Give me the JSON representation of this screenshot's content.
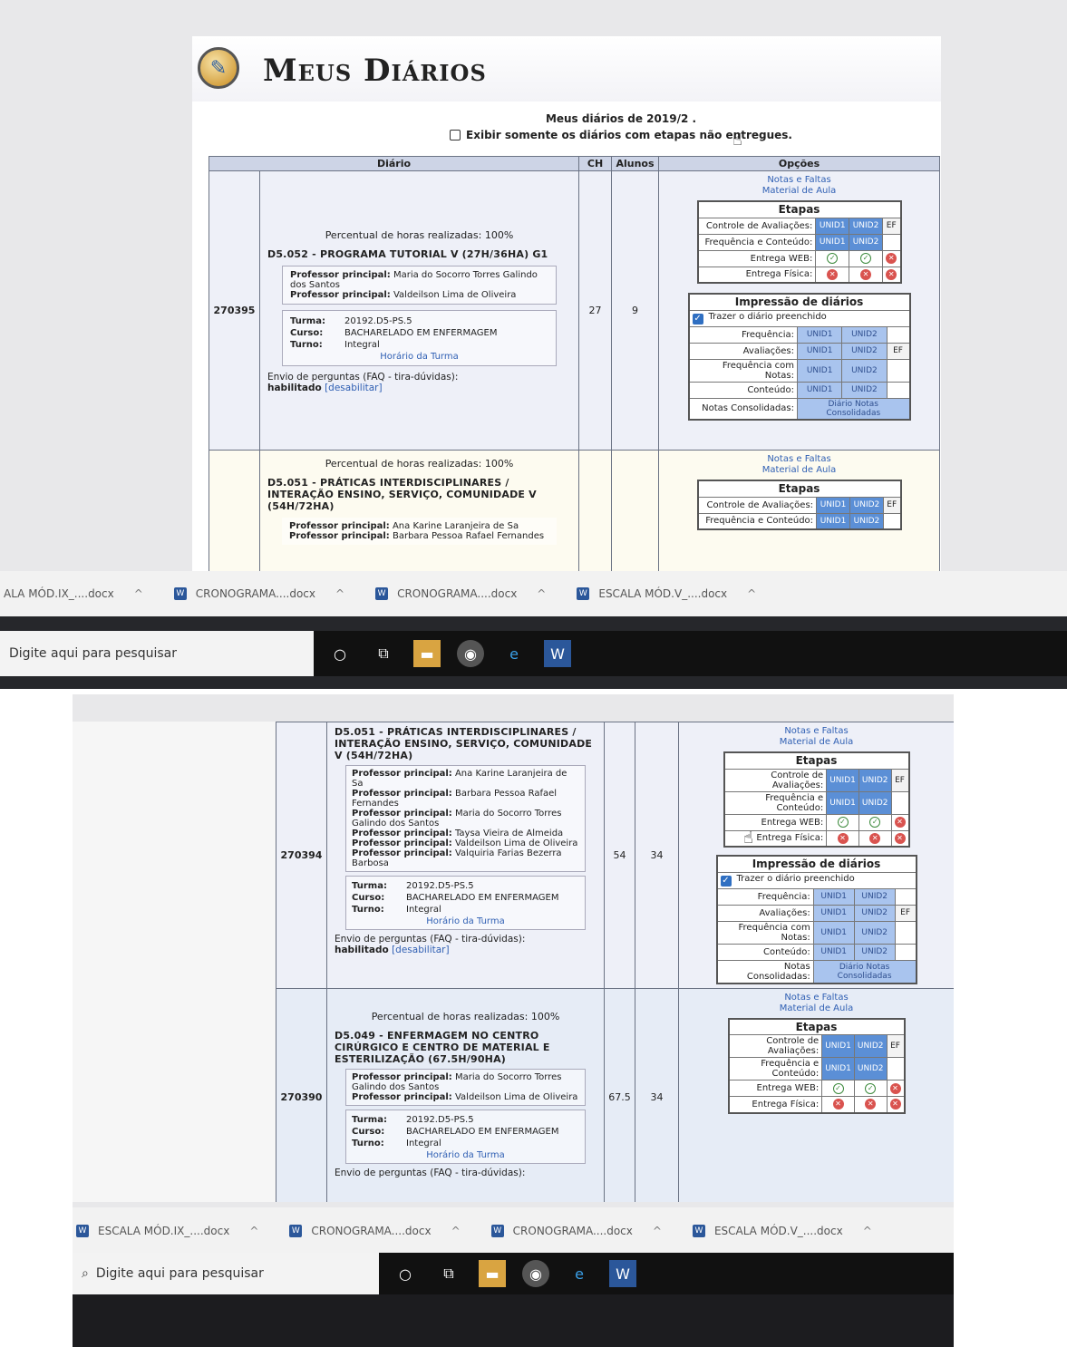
{
  "page": {
    "title": "Meus Diários",
    "subtitle": "Meus diários de 2019/2 .",
    "filter_label": "Exibir somente os diários com etapas não entregues."
  },
  "table": {
    "headers": [
      "Diário",
      "CH",
      "Alunos",
      "Opções"
    ]
  },
  "labels": {
    "percent": "Percentual de horas realizadas: 100%",
    "prof": "Professor principal:",
    "turma": "Turma:",
    "curso": "Curso:",
    "turno": "Turno:",
    "horario": "Horário da Turma",
    "faq": "Envio de perguntas (FAQ - tira-dúvidas):",
    "habilitado": "habilitado",
    "desabilitar": "[desabilitar]",
    "notas_faltas": "Notas e Faltas",
    "material": "Material de Aula",
    "etapas": "Etapas",
    "controle": "Controle de Avaliações:",
    "freq_conteudo": "Frequência e Conteúdo:",
    "entrega_web": "Entrega WEB:",
    "entrega_fisica": "Entrega Física:",
    "impressao": "Impressão de diários",
    "trazer": "Trazer o diário preenchido",
    "frequencia": "Frequência:",
    "avaliacoes": "Avaliações:",
    "freq_notas": "Frequência com Notas:",
    "conteudo": "Conteúdo:",
    "notas_consol": "Notas Consolidadas:",
    "diario_notas": "Diário Notas Consolidadas",
    "unid1": "UNID1",
    "unid2": "UNID2",
    "ef": "EF"
  },
  "diarios": [
    {
      "id": "270395",
      "name": "D5.052 - PROGRAMA TUTORIAL V (27H/36HA) G1",
      "ch": "27",
      "alunos": "9",
      "profs": [
        "Maria do Socorro Torres Galindo dos Santos",
        "Valdeilson Lima de Oliveira"
      ],
      "turma": "20192.D5-PS.5",
      "curso": "BACHARELADO EM ENFERMAGEM",
      "turno": "Integral"
    },
    {
      "id": "270394",
      "name": "D5.051 - PRÁTICAS INTERDISCIPLINARES / INTERAÇÃO ENSINO, SERVIÇO, COMUNIDADE V (54H/72HA)",
      "ch": "54",
      "alunos": "34",
      "profs": [
        "Ana Karine Laranjeira de Sa",
        "Barbara Pessoa Rafael Fernandes",
        "Maria do Socorro Torres Galindo dos Santos",
        "Taysa Vieira de Almeida",
        "Valdeilson Lima de Oliveira",
        "Valquiria Farias Bezerra Barbosa"
      ],
      "turma": "20192.D5-PS.5",
      "curso": "BACHARELADO EM ENFERMAGEM",
      "turno": "Integral"
    },
    {
      "id": "270390",
      "name": "D5.049 - ENFERMAGEM NO CENTRO CIRÚRGICO E CENTRO DE MATERIAL E ESTERILIZAÇÃO (67.5H/90HA)",
      "ch": "67.5",
      "alunos": "34",
      "profs": [
        "Maria do Socorro Torres Galindo dos Santos",
        "Valdeilson Lima de Oliveira"
      ],
      "turma": "20192.D5-PS.5",
      "curso": "BACHARELADO EM ENFERMAGEM",
      "turno": "Integral"
    }
  ],
  "downloads": [
    "ESCALA MÓD.IX_....docx",
    "CRONOGRAMA....docx",
    "CRONOGRAMA....docx",
    "ESCALA MÓD.V_....docx"
  ],
  "downloads_a": [
    "ALA MÓD.IX_....docx",
    "CRONOGRAMA....docx",
    "CRONOGRAMA....docx",
    "ESCALA MÓD.V_....docx"
  ],
  "taskbar": {
    "search_placeholder": "Digite aqui para pesquisar"
  },
  "icons": [
    "diary-logo-icon",
    "search-icon",
    "task-view-icon",
    "file-explorer-icon",
    "chrome-icon",
    "edge-icon",
    "word-icon",
    "word-doc-icon",
    "check-icon",
    "cancel-icon",
    "pointer-cursor-icon"
  ]
}
